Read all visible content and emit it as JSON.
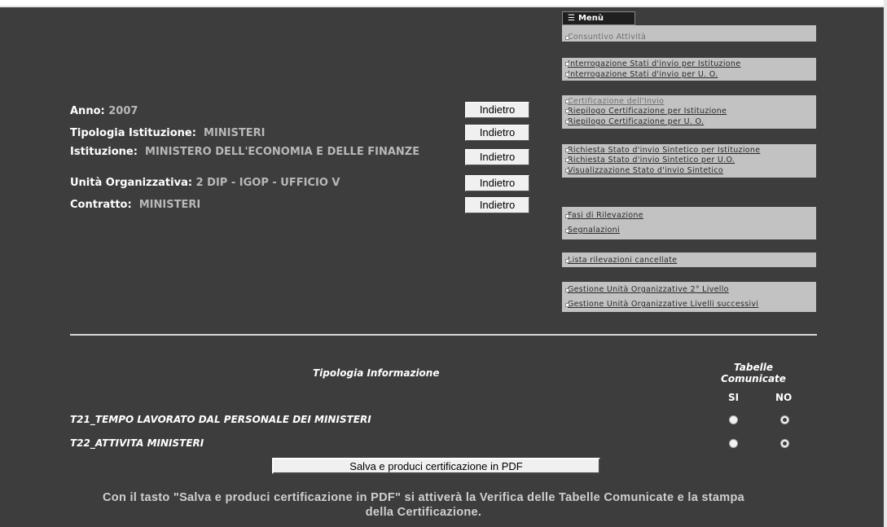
{
  "info": {
    "anno_label": "Anno:",
    "anno_value": "2007",
    "tipologia_label": "Tipologia Istituzione:",
    "tipologia_value": "MINISTERI",
    "istituzione_label": "Istituzione:",
    "istituzione_value": "MINISTERO DELL'ECONOMIA E DELLE FINANZE",
    "unita_label": "Unità Organizzativa:",
    "unita_value": "2 DIP - IGOP - UFFICIO V",
    "contratto_label": "Contratto:",
    "contratto_value": "MINISTERI",
    "back_label": "Indietro"
  },
  "menu": {
    "title": "Menù",
    "groups": [
      [
        "Consuntivo Attività"
      ],
      [
        "Interrogazione Stati d'invio per Istituzione",
        "Interrogazione Stati d'invio per U. O."
      ],
      [
        "Certificazione dell'Invio",
        "Riepilogo Certificazione per Istituzione",
        "Riepilogo Certificazione per U. O."
      ],
      [
        "Richiesta Stato d'invio Sintetico per Istituzione",
        "Richiesta Stato d'invio Sintetico per U.O.",
        "Visualizzazione Stato d'invio Sintetico"
      ],
      [
        "Fasi di Rilevazione",
        "Segnalazioni"
      ],
      [
        "Lista rilevazioni cancellate"
      ],
      [
        "Gestione Unità Organizzative 2° Livello",
        "Gestione Unità Organizzative Livelli successivi"
      ]
    ]
  },
  "table": {
    "col_tipologia": "Tipologia Informazione",
    "col_tabelle": "Tabelle Comunicate",
    "col_si": "SI",
    "col_no": "NO",
    "rows": [
      {
        "label": "T21_TEMPO LAVORATO DAL PERSONALE DEI MINISTERI",
        "selected": "NO"
      },
      {
        "label": "T22_ATTIVITA MINISTERI",
        "selected": "NO"
      }
    ]
  },
  "pdf_button": "Salva e produci certificazione in PDF",
  "footer": "Con il tasto \"Salva e produci certificazione in PDF\" si attiverà la Verifica delle Tabelle Comunicate e la stampa della Certificazione.",
  "colors": {
    "background": "#3d3d3d",
    "menu_box": "#c2c2c2",
    "value_text": "#b8b8b8"
  }
}
